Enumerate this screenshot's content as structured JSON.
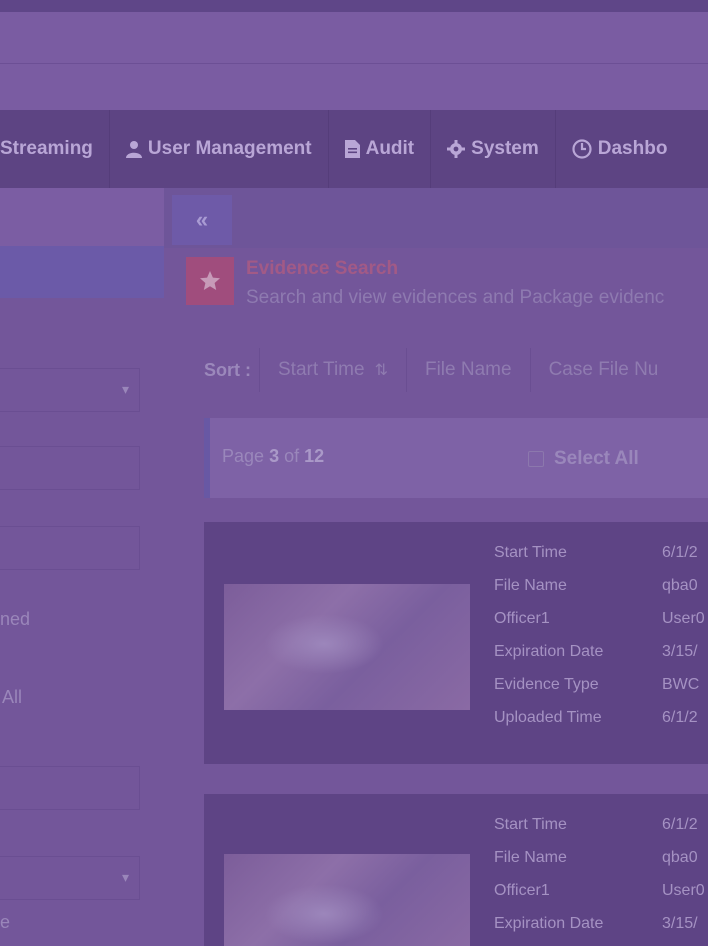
{
  "nav": {
    "items": [
      {
        "label": "Streaming",
        "icon": ""
      },
      {
        "label": "User Management",
        "icon": "user-icon"
      },
      {
        "label": "Audit",
        "icon": "document-icon"
      },
      {
        "label": "System",
        "icon": "gear-icon"
      },
      {
        "label": "Dashbo",
        "icon": "dashboard-icon"
      }
    ]
  },
  "sidebar": {
    "partial_text_1": "ned",
    "partial_text_2": "All",
    "partial_text_3": "e"
  },
  "header": {
    "title": "Evidence Search",
    "subtitle": "Search and view evidences and Package evidenc"
  },
  "sort": {
    "label": "Sort :",
    "options": [
      "Start Time",
      "File Name",
      "Case File Nu"
    ]
  },
  "pager": {
    "page_prefix": "Page",
    "current_page": "3",
    "of_label": "of",
    "total_pages": "12",
    "select_all_label": "Select All"
  },
  "cards": [
    {
      "fields": [
        {
          "label": "Start Time",
          "value": "6/1/2"
        },
        {
          "label": "File Name",
          "value": "qba0"
        },
        {
          "label": "Officer1",
          "value": "User0"
        },
        {
          "label": "Expiration Date",
          "value": "3/15/"
        },
        {
          "label": "Evidence Type",
          "value": "BWC"
        },
        {
          "label": "Uploaded Time",
          "value": "6/1/2"
        }
      ]
    },
    {
      "fields": [
        {
          "label": "Start Time",
          "value": "6/1/2"
        },
        {
          "label": "File Name",
          "value": "qba0"
        },
        {
          "label": "Officer1",
          "value": "User0"
        },
        {
          "label": "Expiration Date",
          "value": "3/15/"
        }
      ]
    }
  ],
  "colors": {
    "overlay": "#73569a",
    "nav_bg": "#5d4483",
    "card_bg": "#5e4485",
    "title_accent": "#a25a86"
  }
}
